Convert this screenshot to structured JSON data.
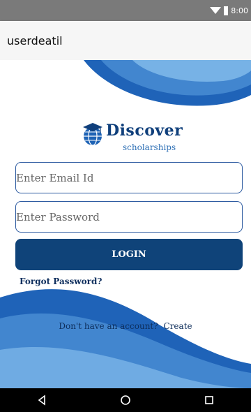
{
  "status_bar": {
    "time": "8:00"
  },
  "app_bar": {
    "title": "userdeatil"
  },
  "logo": {
    "title": "Discover",
    "subtitle": "scholarships"
  },
  "form": {
    "email_placeholder": "Enter Email Id",
    "password_placeholder": "Enter Password",
    "login_label": "LOGIN",
    "forgot_label": "Forgot Password?"
  },
  "signup": {
    "prompt": "Don't have an account?",
    "link": "Create"
  },
  "nav": {
    "icons": [
      "back-icon",
      "home-icon",
      "recents-icon"
    ]
  },
  "colors": {
    "primary": "#0f4379",
    "accent": "#2d6fb5",
    "status": "#7a7a7a"
  }
}
